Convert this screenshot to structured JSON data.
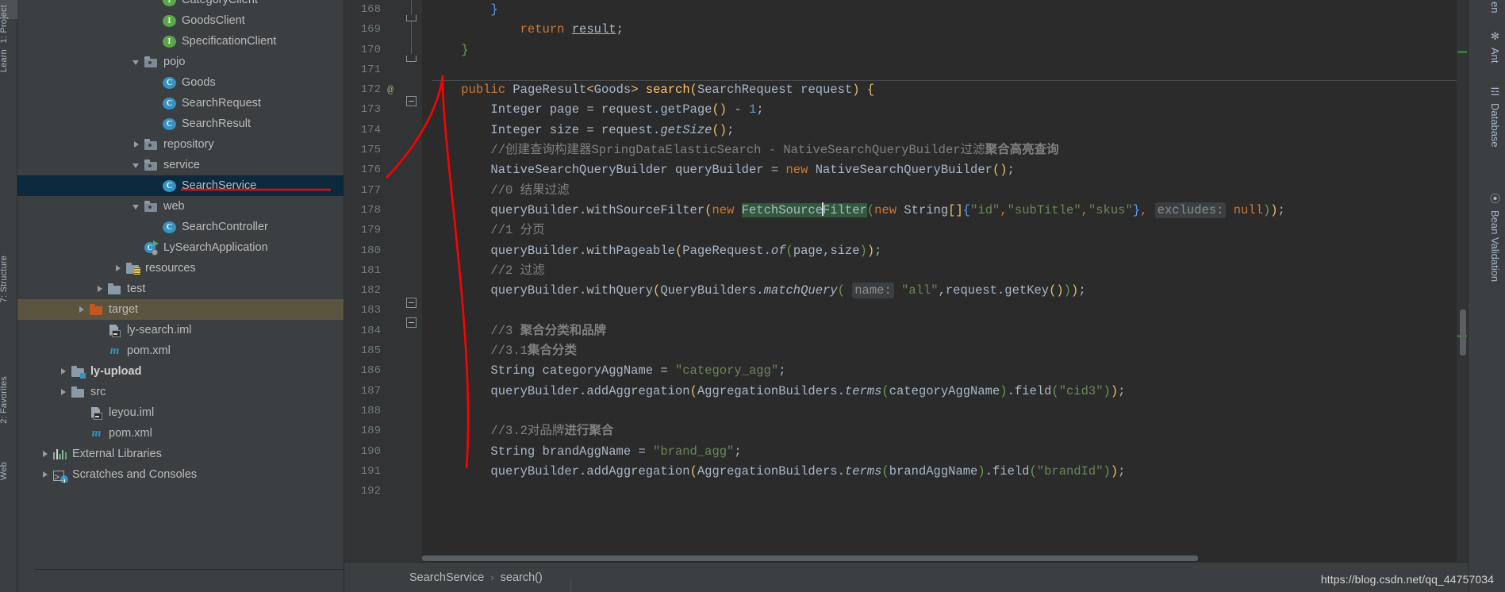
{
  "left_strip": {
    "tabs": [
      {
        "label": "1: Project",
        "icon": "project-icon"
      },
      {
        "label": "Learn",
        "icon": "learn-icon"
      },
      {
        "label": "7: Structure",
        "icon": "structure-icon"
      },
      {
        "label": "2: Favorites",
        "icon": "star-icon"
      },
      {
        "label": "Web",
        "icon": "web-icon"
      }
    ]
  },
  "project_tree": {
    "items": [
      {
        "label": "CategoryClient",
        "icon": "interface-icon",
        "glyph": "I",
        "indent": 7,
        "arrow": "none",
        "state": "normal",
        "clipped_top": true
      },
      {
        "label": "GoodsClient",
        "icon": "interface-icon",
        "glyph": "I",
        "indent": 7,
        "arrow": "none",
        "state": "normal"
      },
      {
        "label": "SpecificationClient",
        "icon": "interface-icon",
        "glyph": "I",
        "indent": 7,
        "arrow": "none",
        "state": "normal"
      },
      {
        "label": "pojo",
        "icon": "package-folder-icon",
        "indent": 6,
        "arrow": "open",
        "state": "normal"
      },
      {
        "label": "Goods",
        "icon": "class-icon",
        "glyph": "C",
        "indent": 7,
        "arrow": "none",
        "state": "normal"
      },
      {
        "label": "SearchRequest",
        "icon": "class-icon",
        "glyph": "C",
        "indent": 7,
        "arrow": "none",
        "state": "normal"
      },
      {
        "label": "SearchResult",
        "icon": "class-icon",
        "glyph": "C",
        "indent": 7,
        "arrow": "none",
        "state": "normal"
      },
      {
        "label": "repository",
        "icon": "package-folder-icon",
        "indent": 6,
        "arrow": "closed",
        "state": "normal"
      },
      {
        "label": "service",
        "icon": "package-folder-icon",
        "indent": 6,
        "arrow": "open",
        "state": "normal"
      },
      {
        "label": "SearchService",
        "icon": "class-icon",
        "glyph": "C",
        "indent": 7,
        "arrow": "none",
        "state": "selected"
      },
      {
        "label": "web",
        "icon": "package-folder-icon",
        "indent": 6,
        "arrow": "open",
        "state": "normal"
      },
      {
        "label": "SearchController",
        "icon": "class-icon",
        "glyph": "C",
        "indent": 7,
        "arrow": "none",
        "state": "normal"
      },
      {
        "label": "LySearchApplication",
        "icon": "runnable-class-icon",
        "glyph": "C",
        "indent": 6,
        "arrow": "none",
        "state": "normal"
      },
      {
        "label": "resources",
        "icon": "resources-folder-icon",
        "indent": 5,
        "arrow": "closed",
        "state": "normal"
      },
      {
        "label": "test",
        "icon": "folder-icon",
        "indent": 4,
        "arrow": "closed",
        "state": "normal"
      },
      {
        "label": "target",
        "icon": "excluded-folder-icon",
        "indent": 3,
        "arrow": "closed",
        "state": "highlighted"
      },
      {
        "label": "ly-search.iml",
        "icon": "iml-file-icon",
        "indent": 4,
        "arrow": "none",
        "state": "normal"
      },
      {
        "label": "pom.xml",
        "icon": "maven-icon",
        "indent": 4,
        "arrow": "none",
        "state": "normal"
      },
      {
        "label": "ly-upload",
        "icon": "module-folder-icon",
        "indent": 2,
        "arrow": "closed",
        "state": "normal",
        "bold": true
      },
      {
        "label": "src",
        "icon": "folder-icon",
        "indent": 2,
        "arrow": "closed",
        "state": "normal"
      },
      {
        "label": "leyou.iml",
        "icon": "iml-file-icon",
        "indent": 3,
        "arrow": "none",
        "state": "normal"
      },
      {
        "label": "pom.xml",
        "icon": "maven-icon",
        "indent": 3,
        "arrow": "none",
        "state": "normal"
      },
      {
        "label": "External Libraries",
        "icon": "libraries-icon",
        "indent": 1,
        "arrow": "closed",
        "state": "normal"
      },
      {
        "label": "Scratches and Consoles",
        "icon": "scratches-icon",
        "indent": 1,
        "arrow": "closed",
        "state": "normal"
      }
    ]
  },
  "editor": {
    "first_line_number": 168,
    "lines": [
      {
        "n": 168,
        "tokens": [
          {
            "t": "        ",
            "c": "punc"
          },
          {
            "t": "}",
            "c": "br-g"
          }
        ]
      },
      {
        "n": 169,
        "tokens": [
          {
            "t": "            ",
            "c": "punc"
          },
          {
            "t": "return",
            "c": "kw"
          },
          {
            "t": " ",
            "c": "punc"
          },
          {
            "t": "result",
            "c": "und"
          },
          {
            "t": ";",
            "c": "punc"
          }
        ]
      },
      {
        "n": 170,
        "tokens": [
          {
            "t": "    ",
            "c": "punc"
          },
          {
            "t": "}",
            "c": "br-gr"
          }
        ]
      },
      {
        "n": 171,
        "tokens": []
      },
      {
        "n": 172,
        "tokens": [
          {
            "t": "    ",
            "c": "punc"
          },
          {
            "t": "public",
            "c": "kw"
          },
          {
            "t": " ",
            "c": "punc"
          },
          {
            "t": "PageResult",
            "c": "punc"
          },
          {
            "t": "<",
            "c": "br-y"
          },
          {
            "t": "Goods",
            "c": "punc"
          },
          {
            "t": ">",
            "c": "br-y"
          },
          {
            "t": " ",
            "c": "punc"
          },
          {
            "t": "search",
            "c": "mth"
          },
          {
            "t": "(",
            "c": "br-y"
          },
          {
            "t": "SearchRequest request",
            "c": "punc"
          },
          {
            "t": ")",
            "c": "br-y"
          },
          {
            "t": " ",
            "c": "punc"
          },
          {
            "t": "{",
            "c": "br-y"
          }
        ]
      },
      {
        "n": 173,
        "tokens": [
          {
            "t": "        Integer page = request.",
            "c": "punc"
          },
          {
            "t": "getPage",
            "c": "punc"
          },
          {
            "t": "(",
            "c": "br-y"
          },
          {
            "t": ")",
            "c": "br-y"
          },
          {
            "t": " - ",
            "c": "punc"
          },
          {
            "t": "1",
            "c": "num"
          },
          {
            "t": ";",
            "c": "punc"
          }
        ]
      },
      {
        "n": 174,
        "tokens": [
          {
            "t": "        Integer size = request.",
            "c": "punc"
          },
          {
            "t": "getSize",
            "c": "ital"
          },
          {
            "t": "(",
            "c": "br-y"
          },
          {
            "t": ")",
            "c": "br-y"
          },
          {
            "t": ";",
            "c": "punc"
          }
        ]
      },
      {
        "n": 175,
        "tokens": [
          {
            "t": "        //创建查询构建器SpringDataElasticSearch - NativeSearchQueryBuilder过滤",
            "c": "cmt"
          },
          {
            "t": "聚合高亮查询",
            "c": "cmtb"
          }
        ]
      },
      {
        "n": 176,
        "tokens": [
          {
            "t": "        NativeSearchQueryBuilder queryBuilder = ",
            "c": "punc"
          },
          {
            "t": "new",
            "c": "kw"
          },
          {
            "t": " NativeSearchQueryBuilder",
            "c": "punc"
          },
          {
            "t": "(",
            "c": "br-y"
          },
          {
            "t": ")",
            "c": "br-y"
          },
          {
            "t": ";",
            "c": "punc"
          }
        ]
      },
      {
        "n": 177,
        "tokens": [
          {
            "t": "        //0 结果过滤",
            "c": "cmt"
          }
        ]
      },
      {
        "n": 178,
        "tokens": [
          {
            "t": "        queryBuilder.withSourceFilter",
            "c": "punc"
          },
          {
            "t": "(",
            "c": "br-y"
          },
          {
            "t": "new",
            "c": "kw"
          },
          {
            "t": " ",
            "c": "punc"
          },
          {
            "t": "FetchSourceFilter",
            "c": "sel-hl"
          },
          {
            "t": "(",
            "c": "br-gr"
          },
          {
            "t": "new",
            "c": "kw"
          },
          {
            "t": " String",
            "c": "punc"
          },
          {
            "t": "[]",
            "c": "br-y"
          },
          {
            "t": "{",
            "c": "br-g"
          },
          {
            "t": "\"id\"",
            "c": "str"
          },
          {
            "t": ",",
            "c": "cc7832"
          },
          {
            "t": "\"subTitle\"",
            "c": "str"
          },
          {
            "t": ",",
            "c": "cc7832"
          },
          {
            "t": "\"skus\"",
            "c": "str"
          },
          {
            "t": "}",
            "c": "br-g"
          },
          {
            "t": ", ",
            "c": "cc7832"
          },
          {
            "t": "excludes:",
            "c": "hint"
          },
          {
            "t": " ",
            "c": "punc"
          },
          {
            "t": "null",
            "c": "kw"
          },
          {
            "t": ")",
            "c": "br-gr"
          },
          {
            "t": ")",
            "c": "br-y"
          },
          {
            "t": ";",
            "c": "punc"
          }
        ]
      },
      {
        "n": 179,
        "tokens": [
          {
            "t": "        //1 分页",
            "c": "cmt"
          }
        ]
      },
      {
        "n": 180,
        "tokens": [
          {
            "t": "        queryBuilder.withPageable",
            "c": "punc"
          },
          {
            "t": "(",
            "c": "br-y"
          },
          {
            "t": "PageRequest.",
            "c": "punc"
          },
          {
            "t": "of",
            "c": "ital"
          },
          {
            "t": "(",
            "c": "br-gr"
          },
          {
            "t": "page,size",
            "c": "punc"
          },
          {
            "t": ")",
            "c": "br-gr"
          },
          {
            "t": ")",
            "c": "br-y"
          },
          {
            "t": ";",
            "c": "punc"
          }
        ]
      },
      {
        "n": 181,
        "tokens": [
          {
            "t": "        //2 过滤",
            "c": "cmt"
          }
        ]
      },
      {
        "n": 182,
        "tokens": [
          {
            "t": "        queryBuilder.withQuery",
            "c": "punc"
          },
          {
            "t": "(",
            "c": "br-y"
          },
          {
            "t": "QueryBuilders.",
            "c": "punc"
          },
          {
            "t": "matchQuery",
            "c": "ital"
          },
          {
            "t": "(",
            "c": "br-gr"
          },
          {
            "t": " ",
            "c": "punc"
          },
          {
            "t": "name:",
            "c": "hint"
          },
          {
            "t": " ",
            "c": "punc"
          },
          {
            "t": "\"all\"",
            "c": "str"
          },
          {
            "t": ",request.",
            "c": "punc"
          },
          {
            "t": "getKey",
            "c": "punc"
          },
          {
            "t": "(",
            "c": "br-y"
          },
          {
            "t": ")",
            "c": "br-y"
          },
          {
            "t": ")",
            "c": "br-gr"
          },
          {
            "t": ")",
            "c": "br-y"
          },
          {
            "t": ";",
            "c": "punc"
          }
        ]
      },
      {
        "n": 183,
        "tokens": []
      },
      {
        "n": 184,
        "tokens": [
          {
            "t": "        //3 ",
            "c": "cmt"
          },
          {
            "t": "聚合分类和品牌",
            "c": "cmtb"
          }
        ]
      },
      {
        "n": 185,
        "tokens": [
          {
            "t": "        //3.1",
            "c": "cmt"
          },
          {
            "t": "集合分类",
            "c": "cmtb"
          }
        ]
      },
      {
        "n": 186,
        "tokens": [
          {
            "t": "        String categoryAggName = ",
            "c": "punc"
          },
          {
            "t": "\"category_agg\"",
            "c": "str"
          },
          {
            "t": ";",
            "c": "punc"
          }
        ]
      },
      {
        "n": 187,
        "tokens": [
          {
            "t": "        queryBuilder.addAggregation",
            "c": "punc"
          },
          {
            "t": "(",
            "c": "br-y"
          },
          {
            "t": "AggregationBuilders.",
            "c": "punc"
          },
          {
            "t": "terms",
            "c": "ital"
          },
          {
            "t": "(",
            "c": "br-gr"
          },
          {
            "t": "categoryAggName",
            "c": "punc"
          },
          {
            "t": ")",
            "c": "br-gr"
          },
          {
            "t": ".field",
            "c": "punc"
          },
          {
            "t": "(",
            "c": "br-gr"
          },
          {
            "t": "\"cid3\"",
            "c": "str"
          },
          {
            "t": ")",
            "c": "br-gr"
          },
          {
            "t": ")",
            "c": "br-y"
          },
          {
            "t": ";",
            "c": "punc"
          }
        ]
      },
      {
        "n": 188,
        "tokens": []
      },
      {
        "n": 189,
        "tokens": [
          {
            "t": "        //3.2对品牌",
            "c": "cmt"
          },
          {
            "t": "进行聚合",
            "c": "cmtb"
          }
        ]
      },
      {
        "n": 190,
        "tokens": [
          {
            "t": "        String brandAggName = ",
            "c": "punc"
          },
          {
            "t": "\"brand_agg\"",
            "c": "str"
          },
          {
            "t": ";",
            "c": "punc"
          }
        ]
      },
      {
        "n": 191,
        "tokens": [
          {
            "t": "        queryBuilder.addAggregation",
            "c": "punc"
          },
          {
            "t": "(",
            "c": "br-y"
          },
          {
            "t": "AggregationBuilders.",
            "c": "punc"
          },
          {
            "t": "terms",
            "c": "ital"
          },
          {
            "t": "(",
            "c": "br-gr"
          },
          {
            "t": "brandAggName",
            "c": "punc"
          },
          {
            "t": ")",
            "c": "br-gr"
          },
          {
            "t": ".field",
            "c": "punc"
          },
          {
            "t": "(",
            "c": "br-gr"
          },
          {
            "t": "\"brandId\"",
            "c": "str"
          },
          {
            "t": ")",
            "c": "br-gr"
          },
          {
            "t": ")",
            "c": "br-y"
          },
          {
            "t": ";",
            "c": "punc"
          }
        ]
      },
      {
        "n": 192,
        "tokens": []
      }
    ],
    "annotation_marker": "@",
    "annotation_marker_line": 172
  },
  "breadcrumb": {
    "class": "SearchService",
    "separator": "›",
    "method": "search()"
  },
  "right_strip": {
    "tabs": [
      {
        "label": "en",
        "icon": "maven-icon"
      },
      {
        "label": "Ant",
        "icon": "ant-icon"
      },
      {
        "label": "Database",
        "icon": "database-icon"
      },
      {
        "label": "Bean Validation",
        "icon": "bean-validation-icon"
      }
    ]
  },
  "watermark": "https://blog.csdn.net/qq_44757034",
  "colors": {
    "bg": "#3c3f41",
    "editor_bg": "#2b2b2b",
    "gutter_bg": "#313335",
    "selection": "#0d293e",
    "highlight_row": "#5b5540",
    "annotation_red": "#ff0000",
    "keyword": "#cc7832",
    "string": "#6a8759",
    "comment": "#808080",
    "number": "#6897bb",
    "method": "#ffc66d",
    "text": "#a9b7c6"
  }
}
